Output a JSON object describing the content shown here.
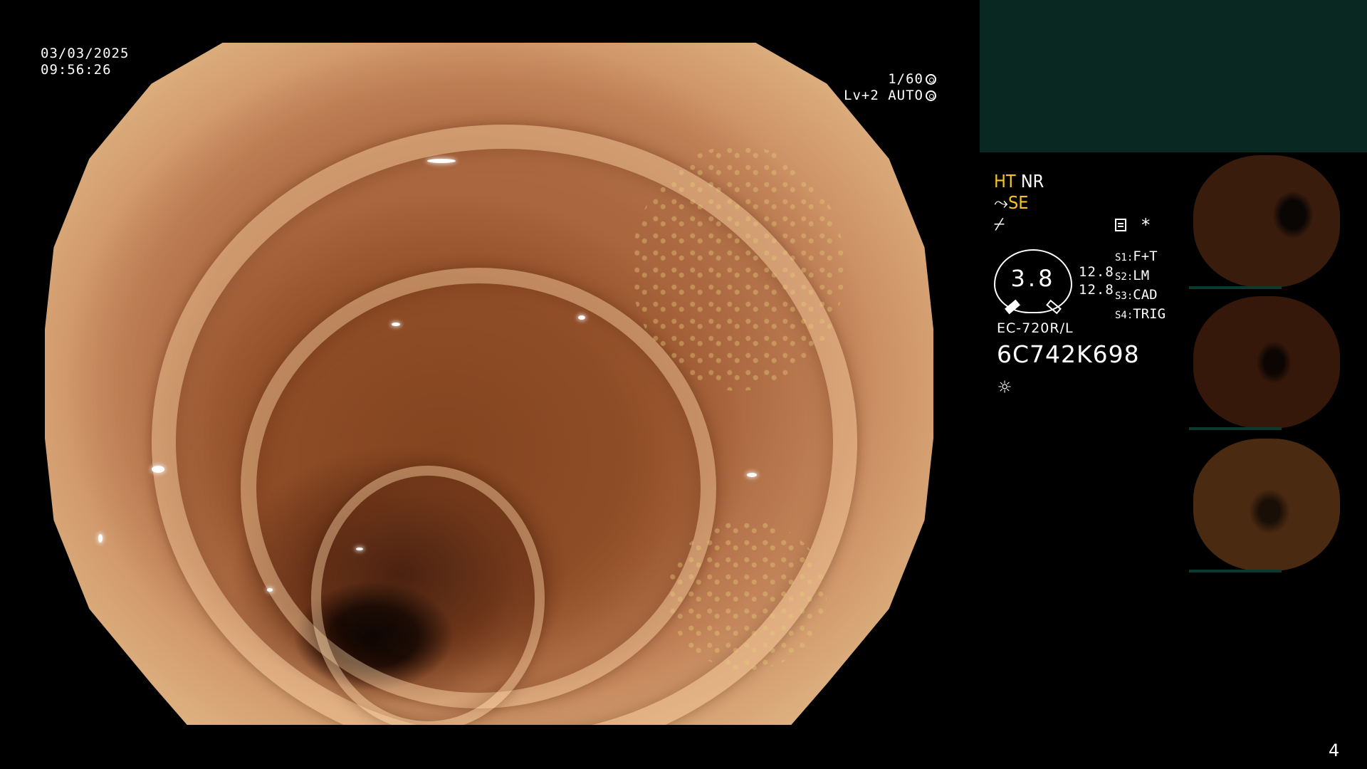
{
  "overlay": {
    "date": "03/03/2025",
    "time": "09:56:26",
    "shutter": "1/60",
    "exposure": "Lv+2 AUTO"
  },
  "status": {
    "ht": "HT",
    "nr": "NR",
    "se_prefix": "⤳",
    "se": "SE",
    "mode_symbol": "⌿"
  },
  "light_meter": {
    "value": "3.8",
    "upper": "12.8",
    "lower": "12.8"
  },
  "switches": [
    {
      "key": "S1:",
      "value": "F+T"
    },
    {
      "key": "S2:",
      "value": "LM"
    },
    {
      "key": "S3:",
      "value": "CAD"
    },
    {
      "key": "S4:",
      "value": "TRIG"
    }
  ],
  "scope": {
    "model": "EC-720R/L",
    "serial": "6C742K698"
  },
  "icons": {
    "shutter_icon": "aperture-icon",
    "auto_icon": "iris-icon",
    "menu_icon": "menu-icon",
    "asterisk": "*",
    "light_icon": "☼"
  },
  "page_number": "4",
  "colors": {
    "top_panel": "#092821",
    "highlight_yellow": "#f6c423"
  }
}
